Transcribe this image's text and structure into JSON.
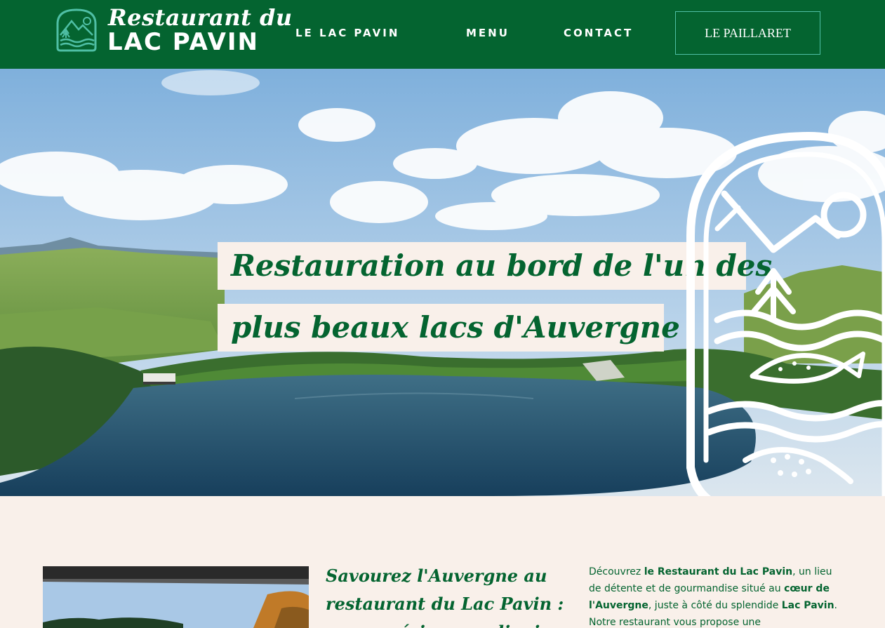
{
  "header": {
    "logo": {
      "script": "Restaurant du",
      "big": "LAC PAVIN"
    },
    "nav": [
      {
        "label": "LE LAC PAVIN"
      },
      {
        "label": "MENU"
      },
      {
        "label": "CONTACT"
      }
    ],
    "cta_label": "LE PAILLARET"
  },
  "hero": {
    "title_line1": "Restauration au bord de l'un des",
    "title_line2": "plus beaux lacs d'Auvergne"
  },
  "content": {
    "subtitle": "Savourez l'Auvergne au restaurant du Lac Pavin : une expérience culinaire",
    "body": {
      "p1": "Découvrez ",
      "b1": "le Restaurant du Lac Pavin",
      "p2": ", un lieu de détente et de gourmandise situé au ",
      "b2": "cœur de l'Auvergne",
      "p3": ", juste à côté du splendide ",
      "b3": "Lac Pavin",
      "p4": ". Notre restaurant vous propose une"
    }
  },
  "colors": {
    "brand_green": "#046430",
    "cream": "#f9f0ea",
    "teal": "#4fbfa5"
  }
}
